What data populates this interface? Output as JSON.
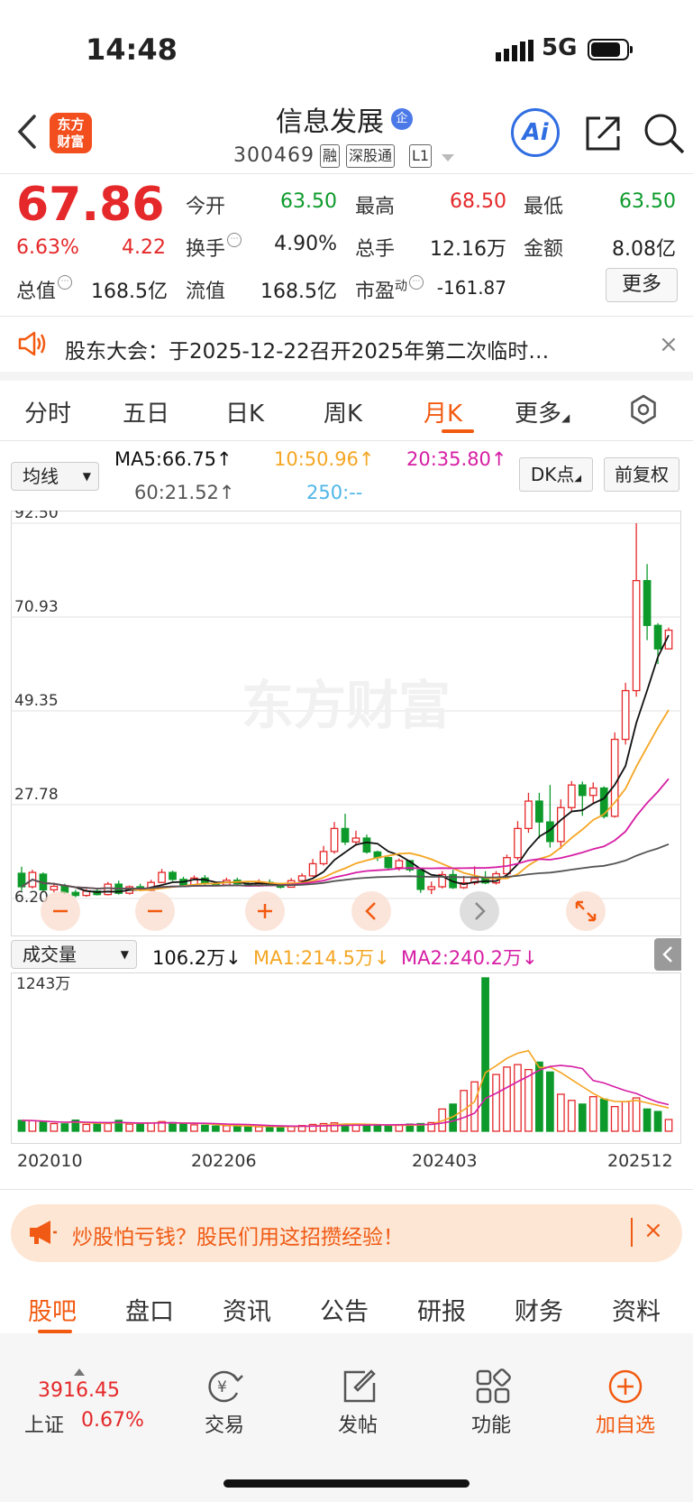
{
  "status_bar": {
    "time": "14:48",
    "network": "5G"
  },
  "header": {
    "logo_line1": "东方",
    "logo_line2": "财富",
    "stock_name": "信息发展",
    "enterprise_badge": "企",
    "stock_code": "300469",
    "tags": [
      "融",
      "深股通",
      "L1"
    ],
    "ai_label": "Ai",
    "icons": [
      "back-arrow-icon",
      "share-icon",
      "search-icon",
      "dropdown-caret-icon"
    ]
  },
  "quote": {
    "price": "67.86",
    "change_pct": "6.63%",
    "change_amt": "4.22",
    "open_label": "今开",
    "open": "63.50",
    "high_label": "最高",
    "high": "68.50",
    "low_label": "最低",
    "low": "63.50",
    "turnover_label": "换手",
    "turnover": "4.90%",
    "volume_label": "总手",
    "volume": "12.16万",
    "amount_label": "金额",
    "amount": "8.08亿",
    "mktcap_label": "总值",
    "mktcap": "168.5亿",
    "float_label": "流值",
    "float_cap": "168.5亿",
    "pe_label": "市盈",
    "pe_sup": "动",
    "pe": "-161.87",
    "more_label": "更多"
  },
  "notice": {
    "text": "股东大会：于2025-12-22召开2025年第二次临时…",
    "close": "×"
  },
  "kline_tabs": {
    "items": [
      "分时",
      "五日",
      "日K",
      "周K",
      "月K",
      "更多"
    ],
    "active": "月K"
  },
  "ma_bar": {
    "selector": "均线",
    "ma5": "MA5:66.75↑",
    "ma10": "10:50.96↑",
    "ma20": "20:35.80↑",
    "ma60": "60:21.52↑",
    "ma250": "250:--",
    "dk_label": "DK点",
    "adjust_label": "前复权"
  },
  "price_axis": [
    "92.50",
    "70.93",
    "49.35",
    "27.78",
    "6.20"
  ],
  "watermark": "东方财富",
  "volume_bar": {
    "selector": "成交量",
    "volume": "106.2万↓",
    "ma1": "MA1:214.5万↓",
    "ma2": "MA2:240.2万↓",
    "max_label": "1243万"
  },
  "x_axis": [
    "202010",
    "202206",
    "202403",
    "202512"
  ],
  "colors": {
    "up": "#e5282a",
    "down": "#0d9a2b",
    "ma5": "#111111",
    "ma10": "#f5a623",
    "ma20": "#d61ea4",
    "ma60": "#555555",
    "accent": "#f25a10"
  },
  "chart_data": {
    "type": "candlestick",
    "period": "monthly",
    "ylim": [
      6.2,
      92.5
    ],
    "candles": [
      {
        "o": 12.0,
        "c": 8.9,
        "h": 13.5,
        "l": 8.0
      },
      {
        "o": 8.9,
        "c": 12.2,
        "h": 12.8,
        "l": 8.5
      },
      {
        "o": 11.8,
        "c": 8.2,
        "h": 12.2,
        "l": 7.6
      },
      {
        "o": 8.2,
        "c": 9.0,
        "h": 9.8,
        "l": 7.6
      },
      {
        "o": 9.0,
        "c": 7.6,
        "h": 9.6,
        "l": 7.2
      },
      {
        "o": 7.6,
        "c": 6.9,
        "h": 8.2,
        "l": 6.5
      },
      {
        "o": 6.9,
        "c": 7.9,
        "h": 8.4,
        "l": 6.6
      },
      {
        "o": 7.9,
        "c": 7.1,
        "h": 8.4,
        "l": 6.9
      },
      {
        "o": 7.1,
        "c": 9.5,
        "h": 10.0,
        "l": 6.9
      },
      {
        "o": 9.5,
        "c": 7.4,
        "h": 10.3,
        "l": 7.1
      },
      {
        "o": 7.4,
        "c": 8.9,
        "h": 9.2,
        "l": 7.1
      },
      {
        "o": 8.9,
        "c": 8.1,
        "h": 9.6,
        "l": 7.9
      },
      {
        "o": 8.1,
        "c": 9.9,
        "h": 10.5,
        "l": 7.9
      },
      {
        "o": 9.9,
        "c": 12.2,
        "h": 13.0,
        "l": 9.7
      },
      {
        "o": 12.2,
        "c": 10.6,
        "h": 12.6,
        "l": 10.2
      },
      {
        "o": 10.6,
        "c": 9.3,
        "h": 11.2,
        "l": 9.0
      },
      {
        "o": 9.3,
        "c": 10.9,
        "h": 11.5,
        "l": 9.1
      },
      {
        "o": 10.9,
        "c": 9.6,
        "h": 11.6,
        "l": 9.2
      },
      {
        "o": 9.6,
        "c": 9.3,
        "h": 9.9,
        "l": 9.0
      },
      {
        "o": 9.3,
        "c": 10.4,
        "h": 11.0,
        "l": 9.2
      },
      {
        "o": 10.4,
        "c": 9.6,
        "h": 11.0,
        "l": 9.4
      },
      {
        "o": 9.6,
        "c": 9.1,
        "h": 10.0,
        "l": 8.9
      },
      {
        "o": 9.1,
        "c": 9.9,
        "h": 10.6,
        "l": 8.9
      },
      {
        "o": 9.9,
        "c": 9.4,
        "h": 10.6,
        "l": 9.2
      },
      {
        "o": 9.4,
        "c": 8.8,
        "h": 9.8,
        "l": 8.5
      },
      {
        "o": 8.8,
        "c": 10.3,
        "h": 10.9,
        "l": 8.7
      },
      {
        "o": 10.3,
        "c": 11.4,
        "h": 12.0,
        "l": 10.1
      },
      {
        "o": 11.4,
        "c": 14.2,
        "h": 15.3,
        "l": 11.2
      },
      {
        "o": 14.2,
        "c": 17.0,
        "h": 18.3,
        "l": 13.8
      },
      {
        "o": 17.0,
        "c": 22.3,
        "h": 23.8,
        "l": 16.5
      },
      {
        "o": 22.3,
        "c": 19.2,
        "h": 25.7,
        "l": 18.5
      },
      {
        "o": 19.2,
        "c": 20.1,
        "h": 21.8,
        "l": 18.3
      },
      {
        "o": 20.1,
        "c": 16.9,
        "h": 20.9,
        "l": 16.5
      },
      {
        "o": 16.9,
        "c": 15.6,
        "h": 17.2,
        "l": 14.8
      },
      {
        "o": 15.6,
        "c": 13.3,
        "h": 15.8,
        "l": 12.8
      },
      {
        "o": 13.3,
        "c": 14.9,
        "h": 15.4,
        "l": 12.6
      },
      {
        "o": 14.9,
        "c": 12.8,
        "h": 15.0,
        "l": 12.3
      },
      {
        "o": 12.8,
        "c": 8.3,
        "h": 13.1,
        "l": 7.5
      },
      {
        "o": 8.3,
        "c": 8.9,
        "h": 10.1,
        "l": 7.2
      },
      {
        "o": 8.9,
        "c": 11.7,
        "h": 12.5,
        "l": 8.5
      },
      {
        "o": 11.7,
        "c": 8.7,
        "h": 12.8,
        "l": 8.4
      },
      {
        "o": 8.7,
        "c": 9.8,
        "h": 11.4,
        "l": 8.4
      },
      {
        "o": 9.8,
        "c": 10.8,
        "h": 13.6,
        "l": 9.3
      },
      {
        "o": 10.8,
        "c": 9.8,
        "h": 12.5,
        "l": 9.5
      },
      {
        "o": 9.8,
        "c": 11.9,
        "h": 12.5,
        "l": 9.4
      },
      {
        "o": 11.9,
        "c": 15.6,
        "h": 16.3,
        "l": 11.4
      },
      {
        "o": 15.6,
        "c": 22.3,
        "h": 24.0,
        "l": 15.0
      },
      {
        "o": 22.3,
        "c": 28.6,
        "h": 30.5,
        "l": 21.3
      },
      {
        "o": 28.6,
        "c": 23.8,
        "h": 30.5,
        "l": 20.0
      },
      {
        "o": 23.8,
        "c": 19.3,
        "h": 32.3,
        "l": 17.9
      },
      {
        "o": 19.3,
        "c": 27.1,
        "h": 29.0,
        "l": 17.6
      },
      {
        "o": 27.1,
        "c": 32.3,
        "h": 33.2,
        "l": 26.4
      },
      {
        "o": 32.3,
        "c": 29.9,
        "h": 33.1,
        "l": 25.2
      },
      {
        "o": 29.9,
        "c": 31.6,
        "h": 32.9,
        "l": 28.3
      },
      {
        "o": 31.6,
        "c": 25.1,
        "h": 32.0,
        "l": 24.6
      },
      {
        "o": 25.1,
        "c": 42.8,
        "h": 44.4,
        "l": 24.8
      },
      {
        "o": 42.8,
        "c": 54.0,
        "h": 55.8,
        "l": 41.6
      },
      {
        "o": 54.0,
        "c": 79.3,
        "h": 92.5,
        "l": 52.6
      },
      {
        "o": 79.3,
        "c": 69.0,
        "h": 83.1,
        "l": 65.6
      },
      {
        "o": 69.0,
        "c": 63.6,
        "h": 69.5,
        "l": 60.1
      },
      {
        "o": 63.6,
        "c": 67.9,
        "h": 68.5,
        "l": 63.5
      }
    ],
    "volume_max": 1243,
    "volume": [
      88,
      85,
      72,
      62,
      60,
      90,
      55,
      58,
      62,
      88,
      58,
      60,
      68,
      78,
      70,
      58,
      52,
      48,
      42,
      45,
      40,
      38,
      36,
      35,
      38,
      40,
      46,
      55,
      62,
      68,
      58,
      52,
      46,
      48,
      42,
      50,
      58,
      62,
      70,
      180,
      220,
      330,
      400,
      1243,
      460,
      520,
      540,
      500,
      560,
      480,
      300,
      250,
      220,
      280,
      260,
      200,
      240,
      270,
      180,
      160,
      95
    ]
  },
  "bottom_ad": {
    "text": "炒股怕亏钱？股民们用这招攒经验！",
    "close": "×"
  },
  "bottom_tabs": {
    "items": [
      "股吧",
      "盘口",
      "资讯",
      "公告",
      "研报",
      "财务",
      "资料"
    ],
    "active": "股吧"
  },
  "bottom_nav": {
    "index_value": "3916.45",
    "index_name": "上证",
    "index_change": "0.67%",
    "items": [
      "交易",
      "发帖",
      "功能",
      "加自选"
    ]
  }
}
